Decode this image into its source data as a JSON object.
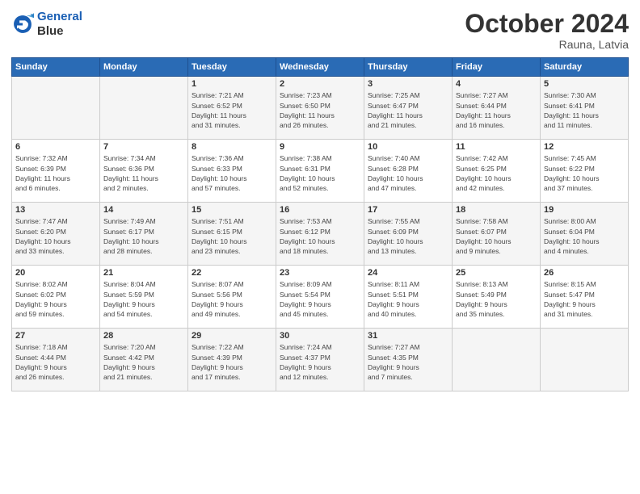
{
  "logo": {
    "line1": "General",
    "line2": "Blue"
  },
  "header": {
    "month": "October 2024",
    "location": "Rauna, Latvia"
  },
  "days_of_week": [
    "Sunday",
    "Monday",
    "Tuesday",
    "Wednesday",
    "Thursday",
    "Friday",
    "Saturday"
  ],
  "weeks": [
    [
      {
        "day": "",
        "info": ""
      },
      {
        "day": "",
        "info": ""
      },
      {
        "day": "1",
        "info": "Sunrise: 7:21 AM\nSunset: 6:52 PM\nDaylight: 11 hours\nand 31 minutes."
      },
      {
        "day": "2",
        "info": "Sunrise: 7:23 AM\nSunset: 6:50 PM\nDaylight: 11 hours\nand 26 minutes."
      },
      {
        "day": "3",
        "info": "Sunrise: 7:25 AM\nSunset: 6:47 PM\nDaylight: 11 hours\nand 21 minutes."
      },
      {
        "day": "4",
        "info": "Sunrise: 7:27 AM\nSunset: 6:44 PM\nDaylight: 11 hours\nand 16 minutes."
      },
      {
        "day": "5",
        "info": "Sunrise: 7:30 AM\nSunset: 6:41 PM\nDaylight: 11 hours\nand 11 minutes."
      }
    ],
    [
      {
        "day": "6",
        "info": "Sunrise: 7:32 AM\nSunset: 6:39 PM\nDaylight: 11 hours\nand 6 minutes."
      },
      {
        "day": "7",
        "info": "Sunrise: 7:34 AM\nSunset: 6:36 PM\nDaylight: 11 hours\nand 2 minutes."
      },
      {
        "day": "8",
        "info": "Sunrise: 7:36 AM\nSunset: 6:33 PM\nDaylight: 10 hours\nand 57 minutes."
      },
      {
        "day": "9",
        "info": "Sunrise: 7:38 AM\nSunset: 6:31 PM\nDaylight: 10 hours\nand 52 minutes."
      },
      {
        "day": "10",
        "info": "Sunrise: 7:40 AM\nSunset: 6:28 PM\nDaylight: 10 hours\nand 47 minutes."
      },
      {
        "day": "11",
        "info": "Sunrise: 7:42 AM\nSunset: 6:25 PM\nDaylight: 10 hours\nand 42 minutes."
      },
      {
        "day": "12",
        "info": "Sunrise: 7:45 AM\nSunset: 6:22 PM\nDaylight: 10 hours\nand 37 minutes."
      }
    ],
    [
      {
        "day": "13",
        "info": "Sunrise: 7:47 AM\nSunset: 6:20 PM\nDaylight: 10 hours\nand 33 minutes."
      },
      {
        "day": "14",
        "info": "Sunrise: 7:49 AM\nSunset: 6:17 PM\nDaylight: 10 hours\nand 28 minutes."
      },
      {
        "day": "15",
        "info": "Sunrise: 7:51 AM\nSunset: 6:15 PM\nDaylight: 10 hours\nand 23 minutes."
      },
      {
        "day": "16",
        "info": "Sunrise: 7:53 AM\nSunset: 6:12 PM\nDaylight: 10 hours\nand 18 minutes."
      },
      {
        "day": "17",
        "info": "Sunrise: 7:55 AM\nSunset: 6:09 PM\nDaylight: 10 hours\nand 13 minutes."
      },
      {
        "day": "18",
        "info": "Sunrise: 7:58 AM\nSunset: 6:07 PM\nDaylight: 10 hours\nand 9 minutes."
      },
      {
        "day": "19",
        "info": "Sunrise: 8:00 AM\nSunset: 6:04 PM\nDaylight: 10 hours\nand 4 minutes."
      }
    ],
    [
      {
        "day": "20",
        "info": "Sunrise: 8:02 AM\nSunset: 6:02 PM\nDaylight: 9 hours\nand 59 minutes."
      },
      {
        "day": "21",
        "info": "Sunrise: 8:04 AM\nSunset: 5:59 PM\nDaylight: 9 hours\nand 54 minutes."
      },
      {
        "day": "22",
        "info": "Sunrise: 8:07 AM\nSunset: 5:56 PM\nDaylight: 9 hours\nand 49 minutes."
      },
      {
        "day": "23",
        "info": "Sunrise: 8:09 AM\nSunset: 5:54 PM\nDaylight: 9 hours\nand 45 minutes."
      },
      {
        "day": "24",
        "info": "Sunrise: 8:11 AM\nSunset: 5:51 PM\nDaylight: 9 hours\nand 40 minutes."
      },
      {
        "day": "25",
        "info": "Sunrise: 8:13 AM\nSunset: 5:49 PM\nDaylight: 9 hours\nand 35 minutes."
      },
      {
        "day": "26",
        "info": "Sunrise: 8:15 AM\nSunset: 5:47 PM\nDaylight: 9 hours\nand 31 minutes."
      }
    ],
    [
      {
        "day": "27",
        "info": "Sunrise: 7:18 AM\nSunset: 4:44 PM\nDaylight: 9 hours\nand 26 minutes."
      },
      {
        "day": "28",
        "info": "Sunrise: 7:20 AM\nSunset: 4:42 PM\nDaylight: 9 hours\nand 21 minutes."
      },
      {
        "day": "29",
        "info": "Sunrise: 7:22 AM\nSunset: 4:39 PM\nDaylight: 9 hours\nand 17 minutes."
      },
      {
        "day": "30",
        "info": "Sunrise: 7:24 AM\nSunset: 4:37 PM\nDaylight: 9 hours\nand 12 minutes."
      },
      {
        "day": "31",
        "info": "Sunrise: 7:27 AM\nSunset: 4:35 PM\nDaylight: 9 hours\nand 7 minutes."
      },
      {
        "day": "",
        "info": ""
      },
      {
        "day": "",
        "info": ""
      }
    ]
  ]
}
